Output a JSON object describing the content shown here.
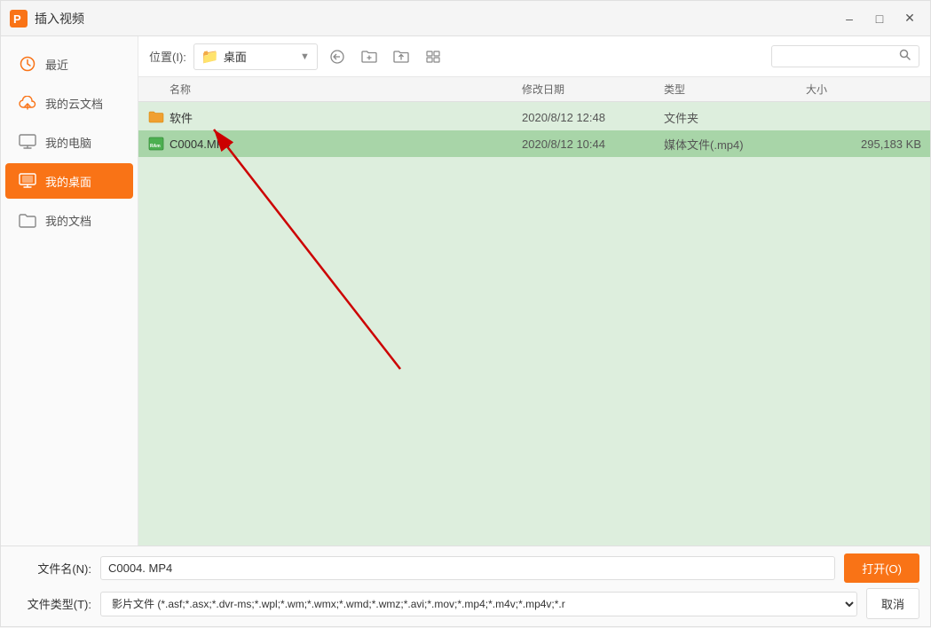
{
  "window": {
    "title": "插入视频",
    "minimize_label": "minimize",
    "maximize_label": "maximize",
    "close_label": "close"
  },
  "toolbar": {
    "location_label": "位置(I):",
    "location_name": "桌面",
    "search_placeholder": ""
  },
  "sidebar": {
    "items": [
      {
        "id": "recent",
        "label": "最近",
        "icon": "clock"
      },
      {
        "id": "cloud",
        "label": "我的云文档",
        "icon": "cloud"
      },
      {
        "id": "computer",
        "label": "我的电脑",
        "icon": "monitor"
      },
      {
        "id": "desktop",
        "label": "我的桌面",
        "icon": "desktop",
        "active": true
      },
      {
        "id": "documents",
        "label": "我的文档",
        "icon": "folder"
      }
    ]
  },
  "file_list": {
    "columns": {
      "name": "名称",
      "date": "修改日期",
      "type": "类型",
      "size": "大小"
    },
    "files": [
      {
        "name": "软件",
        "date": "2020/8/12 12:48",
        "type": "文件夹",
        "size": "",
        "icon": "folder",
        "selected": false
      },
      {
        "name": "C0004.MP4",
        "date": "2020/8/12 10:44",
        "type": "媒体文件(.mp4)",
        "size": "295,183 KB",
        "icon": "video",
        "selected": true
      }
    ]
  },
  "bottom": {
    "filename_label": "文件名(N):",
    "filetype_label": "文件类型(T):",
    "filename_value": "C0004. MP4",
    "filetype_value": "影片文件 (*.asf;*.asx;*.dvr-ms;*.wpl;*.wm;*.wmx;*.wmd;*.wmz;*.avi;*.mov;*.mp4;*.m4v;*.mp4v;*.r",
    "open_btn": "打开(O)",
    "cancel_btn": "取消"
  }
}
